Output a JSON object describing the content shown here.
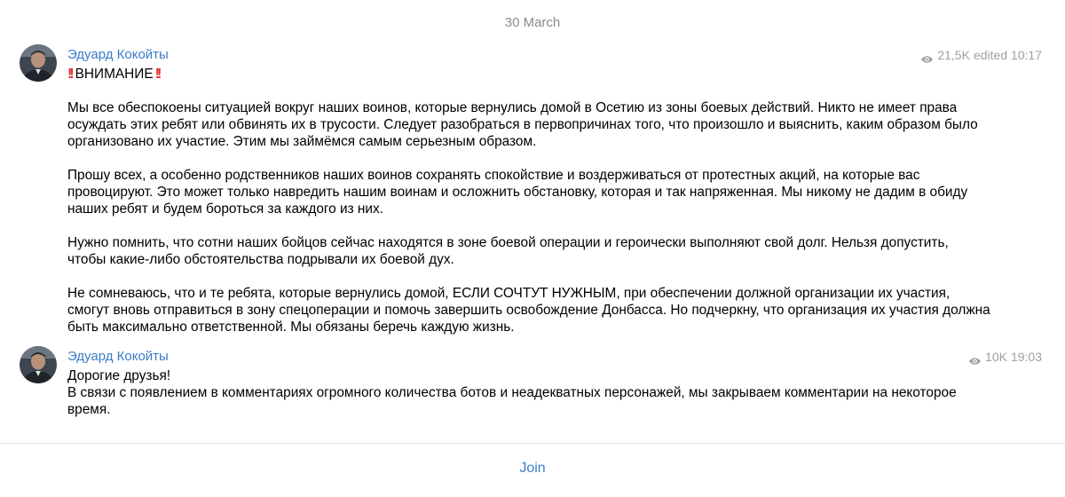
{
  "date_separator": "30 March",
  "messages": [
    {
      "author": "Эдуард Кокойты",
      "views": "21,5K",
      "edited": "edited 10:17",
      "title": "ВНИМАНИЕ",
      "paragraphs": [
        "Мы все обеспокоены ситуацией вокруг наших воинов, которые вернулись домой в Осетию из зоны боевых действий. Никто не имеет права осуждать этих ребят или обвинять их в трусости. Следует разобраться в первопричинах того, что произошло и выяснить, каким образом было организовано их участие. Этим мы займёмся самым серьезным образом.",
        "Прошу всех, а особенно родственников наших воинов сохранять спокойствие и воздерживаться от протестных акций, на которые вас провоцируют. Это может только навредить нашим воинам и осложнить обстановку, которая и так напряженная. Мы никому не дадим в обиду наших ребят и будем бороться за каждого из них.",
        "Нужно помнить, что сотни наших бойцов сейчас находятся в зоне боевой операции и героически выполняют свой долг. Нельзя допустить, чтобы какие-либо обстоятельства подрывали их боевой дух.",
        "Не сомневаюсь, что и те ребята, которые вернулись домой, ЕСЛИ СОЧТУТ НУЖНЫМ, при обеспечении должной организации их участия, смогут вновь отправиться в зону спецоперации и помочь завершить освобождение Донбасса. Но подчеркну, что организация их участия должна быть максимально ответственной. Мы обязаны беречь каждую жизнь."
      ]
    },
    {
      "author": "Эдуард Кокойты",
      "views": "10K",
      "time": "19:03",
      "line1": "Дорогие друзья!",
      "line2": "В связи с появлением в комментариях огромного количества ботов и неадекватных персонажей, мы закрываем комментарии на некоторое время."
    }
  ],
  "footer": {
    "join_label": "Join"
  },
  "icons": {
    "views": "eye-icon",
    "emphasis": "double-exclamation-icon",
    "avatar": "avatar"
  },
  "colors": {
    "author": "#3a7dc8",
    "meta": "#a0a0a0",
    "date": "#8a8a8a",
    "emphasis": "#e0332e",
    "join": "#3a7dc8"
  }
}
